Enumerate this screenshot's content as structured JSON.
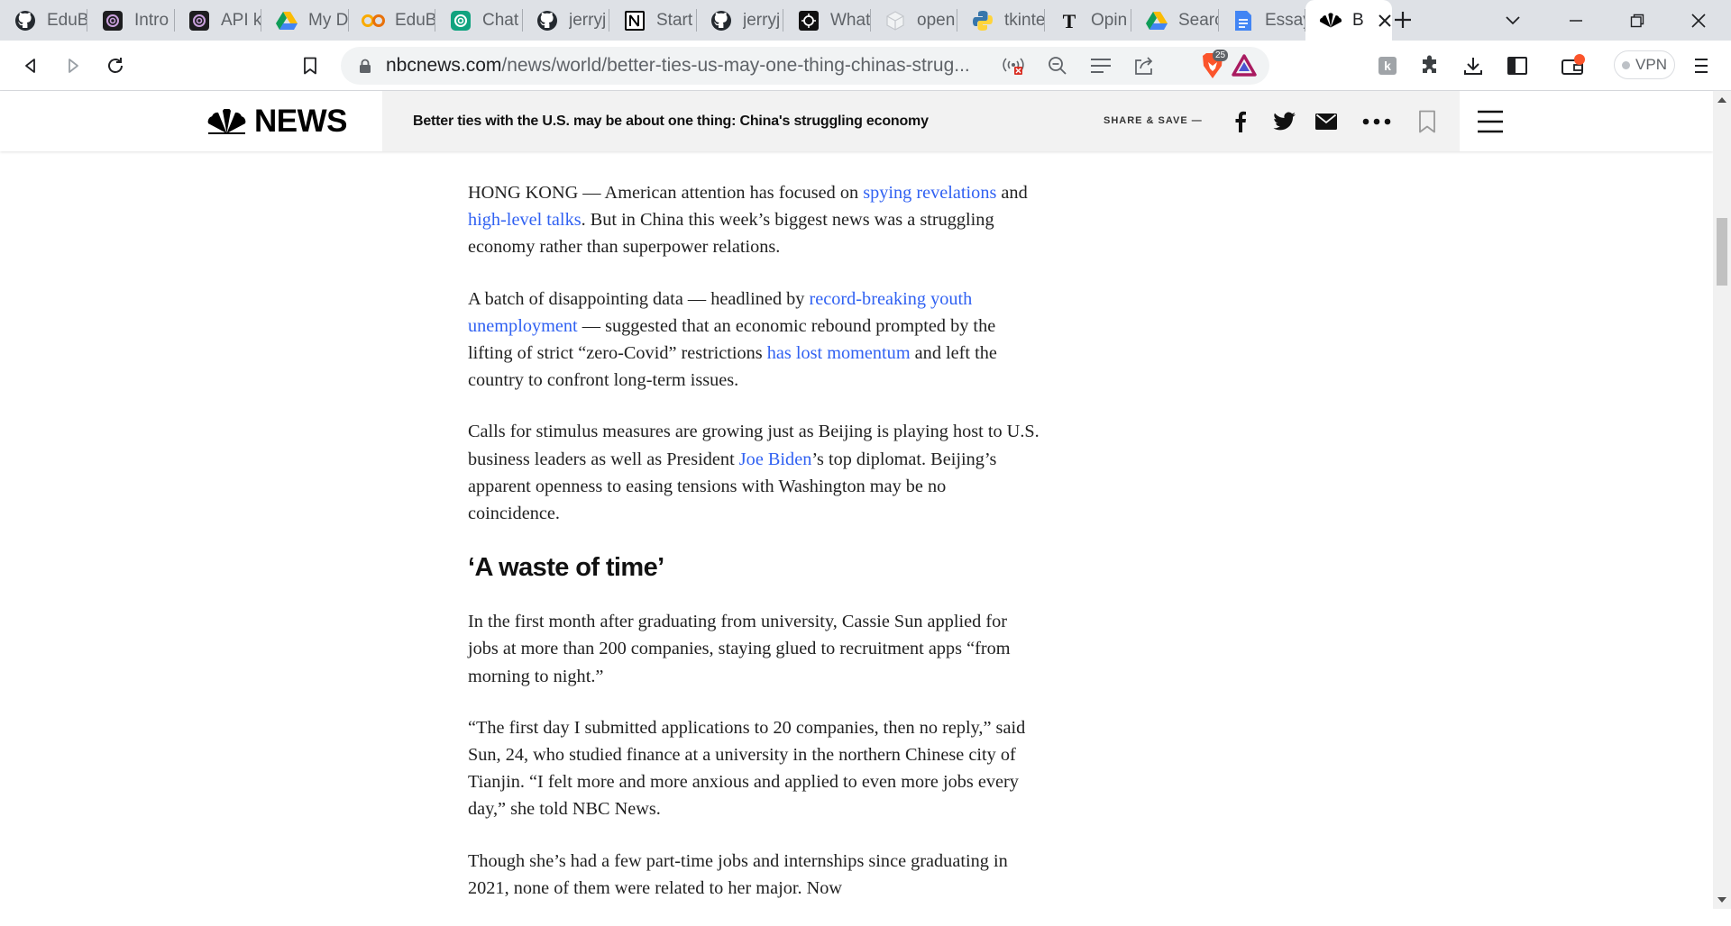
{
  "browser": {
    "tabs": [
      {
        "title": "EduB",
        "icon": "github-icon"
      },
      {
        "title": "Intro",
        "icon": "openai-icon"
      },
      {
        "title": "API k",
        "icon": "openai-icon"
      },
      {
        "title": "My D",
        "icon": "google-drive-icon"
      },
      {
        "title": "EduB",
        "icon": "colab-icon"
      },
      {
        "title": "Chat",
        "icon": "chatgpt-icon"
      },
      {
        "title": "jerryj",
        "icon": "github-icon"
      },
      {
        "title": "Start",
        "icon": "notion-icon"
      },
      {
        "title": "jerryj",
        "icon": "github-icon"
      },
      {
        "title": "What",
        "icon": "ai-icon"
      },
      {
        "title": "open",
        "icon": "cube-icon"
      },
      {
        "title": "tkinte",
        "icon": "python-icon"
      },
      {
        "title": "Opin",
        "icon": "nytimes-icon"
      },
      {
        "title": "Searc",
        "icon": "google-drive-icon"
      },
      {
        "title": "Essay",
        "icon": "google-docs-icon"
      },
      {
        "title": "B",
        "icon": "nbc-peacock-icon",
        "active": true
      }
    ],
    "url_domain": "nbcnews.com",
    "url_path": "/news/world/better-ties-us-may-one-thing-chinas-strug...",
    "brave_shield_count": "25",
    "vpn_label": "VPN"
  },
  "site": {
    "logo_text": "NEWS",
    "headline": "Better ties with the U.S. may be about one thing: China's struggling economy",
    "share_label": "SHARE & SAVE —"
  },
  "article": {
    "p1": {
      "t1": "HONG KONG — American attention has focused on ",
      "l1": "spying revelations",
      "t2": " and ",
      "l2": "high-level talks",
      "t3": ". But in China this week’s biggest news was a struggling economy rather than superpower relations."
    },
    "p2": {
      "t1": "A batch of disappointing data — headlined by ",
      "l1": "record-breaking youth unemployment",
      "t2": " — suggested that an economic rebound prompted by the lifting of strict “zero-Covid” restrictions ",
      "l2": "has lost momentum",
      "t3": " and left the country to confront long-term issues."
    },
    "p3": {
      "t1": "Calls for stimulus measures are growing just as Beijing is playing host to U.S. business leaders as well as President ",
      "l1": "Joe Biden",
      "t2": "’s top diplomat. Beijing’s apparent openness to easing tensions with Washington may be no coincidence."
    },
    "subheading": "‘A waste of time’",
    "p4": "In the first month after graduating from university, Cassie Sun applied for jobs at more than 200 companies, staying glued to recruitment apps “from morning to night.”",
    "p5": "“The first day I submitted applications to 20 companies, then no reply,” said Sun, 24, who studied finance at a university in the northern Chinese city of Tianjin. “I felt more and more anxious and applied to even more jobs every day,” she told NBC News.",
    "p6": "Though she’s had a few part-time jobs and internships since graduating in 2021, none of them were related to her major. Now"
  },
  "colors": {
    "link": "#3061f2",
    "tabstrip": "#dee1e6",
    "headline_bar": "#f2f2f2"
  }
}
